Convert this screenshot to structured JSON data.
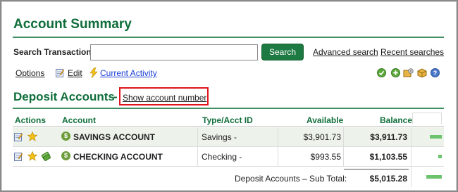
{
  "header": {
    "title": "Account Summary"
  },
  "search": {
    "label": "Search Transactions:",
    "value": "",
    "placeholder": "",
    "button_label": "Search",
    "advanced_label": "Advanced search",
    "recent_label": "Recent searches"
  },
  "toolbar": {
    "options_label": "Options",
    "edit_label": "Edit",
    "activity_label": "Current Activity",
    "icons": [
      "check-circle-icon",
      "add-circle-icon",
      "gear-box-icon",
      "package-icon",
      "help-icon"
    ]
  },
  "section": {
    "title": "Deposit Accounts",
    "separator": "-",
    "show_account_number_label": "Show account number"
  },
  "table": {
    "columns": [
      "Actions",
      "Account",
      "Type/Acct ID",
      "Available",
      "Balance"
    ],
    "rows": [
      {
        "account": "SAVINGS ACCOUNT",
        "type": "Savings -",
        "available": "$3,901.73",
        "balance": "$3,911.73",
        "balance_bar_fraction": 0.78
      },
      {
        "account": "CHECKING ACCOUNT",
        "type": "Checking -",
        "available": "$993.55",
        "balance": "$1,103.55",
        "balance_bar_fraction": 0.22
      }
    ],
    "subtotal_label": "Deposit Accounts – Sub Total:",
    "subtotal_value": "$5,015.28",
    "subtotal_bar_fraction": 1.0
  },
  "colors": {
    "brand_green": "#0f6e3a",
    "button_green": "#1e7a43",
    "row_tint": "#edf3ea",
    "bar_green": "#6cc36c",
    "highlight_red": "#e0141c",
    "link_blue": "#1a3ed6"
  }
}
